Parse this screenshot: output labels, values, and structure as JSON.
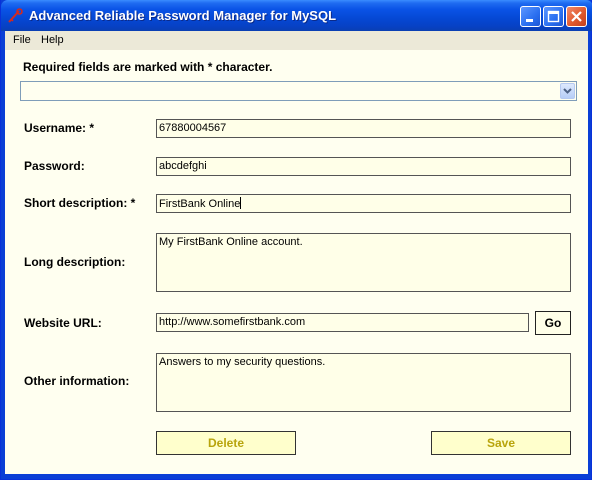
{
  "window": {
    "title": "Advanced Reliable Password Manager for MySQL",
    "controls": [
      "minimize-icon",
      "maximize-icon",
      "close-icon"
    ]
  },
  "menu": {
    "items": [
      {
        "label": "File"
      },
      {
        "label": "Help"
      }
    ]
  },
  "form": {
    "required_note": "Required fields are marked with * character.",
    "record_select": {
      "value": ""
    },
    "fields": {
      "username": {
        "label": "Username: *",
        "value": "67880004567"
      },
      "password": {
        "label": "Password:",
        "value": "abcdefghi"
      },
      "short_description": {
        "label": "Short description: *",
        "value": "FirstBank Online"
      },
      "long_description": {
        "label": "Long description:",
        "value": "My FirstBank Online account."
      },
      "website_url": {
        "label": "Website URL:",
        "value": "http://www.somefirstbank.com"
      },
      "other_information": {
        "label": "Other information:",
        "value": "Answers to my security questions."
      }
    },
    "go_button": "Go",
    "delete_button": "Delete",
    "save_button": "Save"
  },
  "colors": {
    "titlebar_blue": "#0a53e6",
    "form_background": "#fffff0",
    "input_background": "#ffffe8",
    "button_text": "#b8a40c"
  }
}
